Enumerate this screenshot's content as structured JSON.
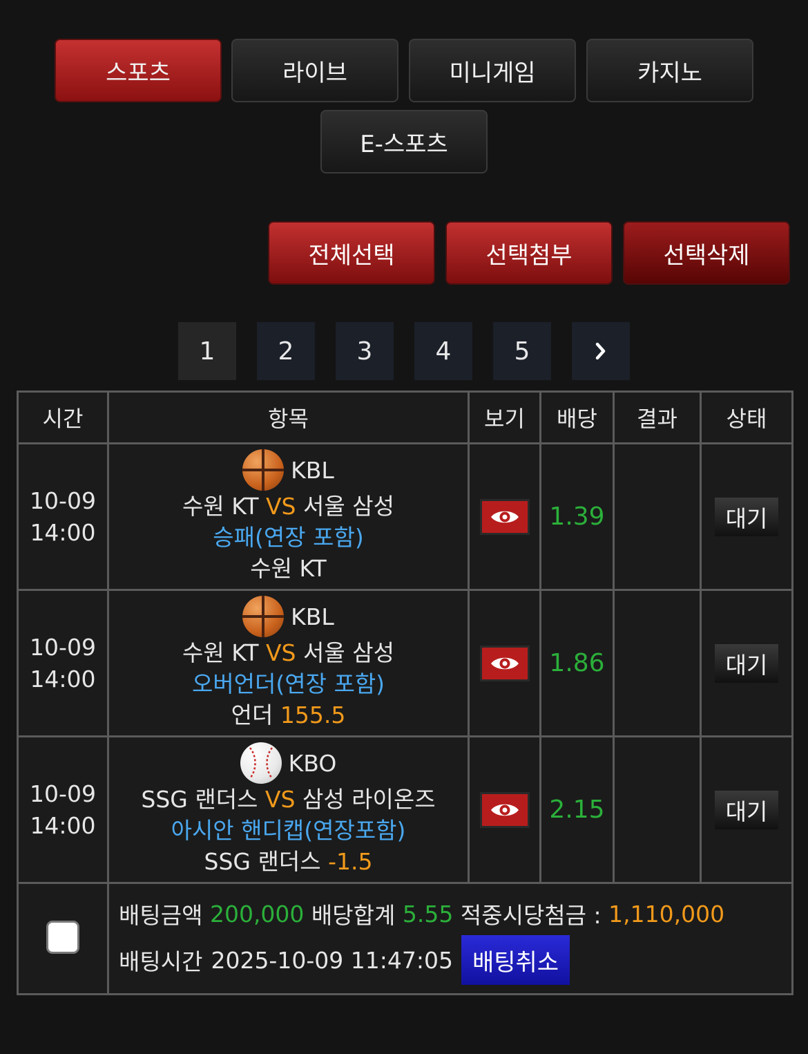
{
  "categories": [
    {
      "label": "스포츠",
      "active": true
    },
    {
      "label": "라이브",
      "active": false
    },
    {
      "label": "미니게임",
      "active": false
    },
    {
      "label": "카지노",
      "active": false
    },
    {
      "label": "E-스포츠",
      "active": false
    }
  ],
  "actions": {
    "select_all": "전체선택",
    "attach": "선택첨부",
    "delete": "선택삭제"
  },
  "pagination": {
    "pages": [
      "1",
      "2",
      "3",
      "4",
      "5"
    ],
    "current": "1",
    "next_icon": "chevron-right-icon"
  },
  "table": {
    "headers": [
      "시간",
      "항목",
      "보기",
      "배당",
      "결과",
      "상태"
    ],
    "rows": [
      {
        "date": "10-09",
        "time": "14:00",
        "sport_icon": "basketball-icon",
        "league": "KBL",
        "home": "수원 KT",
        "vs": "VS",
        "away": "서울 삼성",
        "market": "승패(연장 포함)",
        "pick": "수원 KT",
        "pick_value": "",
        "odds": "1.39",
        "result": "",
        "status": "대기"
      },
      {
        "date": "10-09",
        "time": "14:00",
        "sport_icon": "basketball-icon",
        "league": "KBL",
        "home": "수원 KT",
        "vs": "VS",
        "away": "서울 삼성",
        "market": "오버언더(연장 포함)",
        "pick": "언더",
        "pick_value": "155.5",
        "odds": "1.86",
        "result": "",
        "status": "대기"
      },
      {
        "date": "10-09",
        "time": "14:00",
        "sport_icon": "baseball-icon",
        "league": "KBO",
        "home": "SSG 랜더스",
        "vs": "VS",
        "away": "삼성 라이온즈",
        "market": "아시안 핸디캡(연장포함)",
        "pick": "SSG 랜더스",
        "pick_value": "-1.5",
        "odds": "2.15",
        "result": "",
        "status": "대기"
      }
    ]
  },
  "summary": {
    "bet_amount_label": "배팅금액",
    "bet_amount": "200,000",
    "odds_total_label": "배당합계",
    "odds_total": "5.55",
    "payout_label": "적중시당첨금 :",
    "payout": "1,110,000",
    "bet_time_label": "배팅시간",
    "bet_time": "2025-10-09 11:47:05",
    "cancel_label": "배팅취소"
  },
  "colors": {
    "accent_red": "#b81d1d",
    "vs_orange": "#f29a1b",
    "market_blue": "#4aa8f0",
    "odds_green": "#2bb03a",
    "cancel_blue": "#1a1ac8"
  }
}
